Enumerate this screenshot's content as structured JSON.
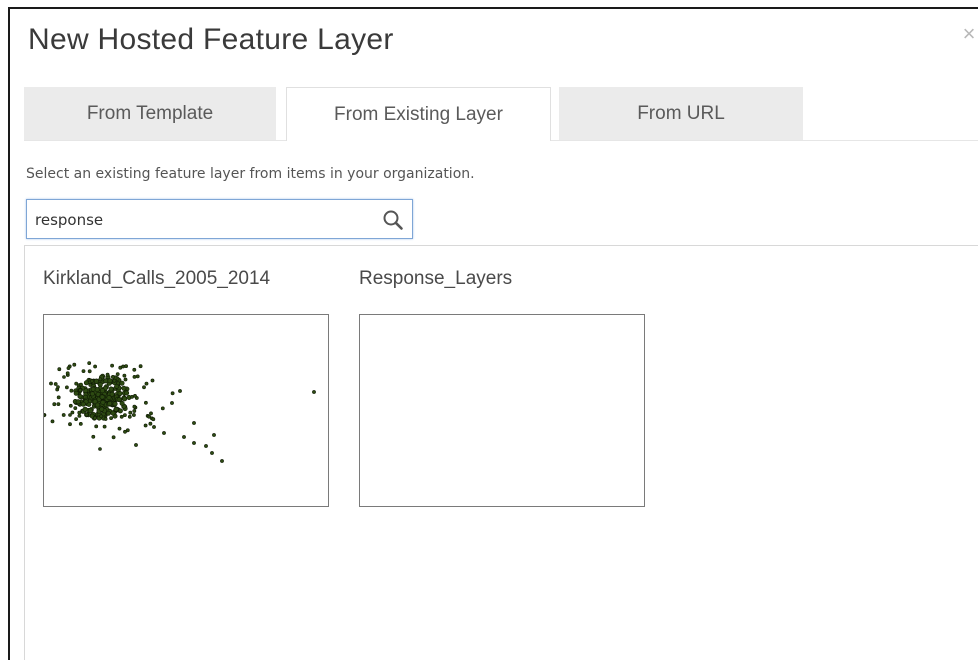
{
  "dialog": {
    "title": "New Hosted Feature Layer",
    "close_glyph": "×"
  },
  "tabs": [
    {
      "label": "From Template",
      "active": false
    },
    {
      "label": "From Existing Layer",
      "active": true
    },
    {
      "label": "From URL",
      "active": false
    }
  ],
  "instructions": "Select an existing feature layer from items in your organization.",
  "search": {
    "value": "response",
    "icon": "search-icon"
  },
  "results": [
    {
      "title": "Kirkland_Calls_2005_2014",
      "thumbnail": "point-cluster-map"
    },
    {
      "title": "Response_Layers",
      "thumbnail": "blank"
    }
  ],
  "colors": {
    "accent": "#7fa6d6",
    "tab_inactive": "#ebebeb",
    "point_fill": "#2d4a12",
    "point_stroke": "#0f1a05"
  }
}
